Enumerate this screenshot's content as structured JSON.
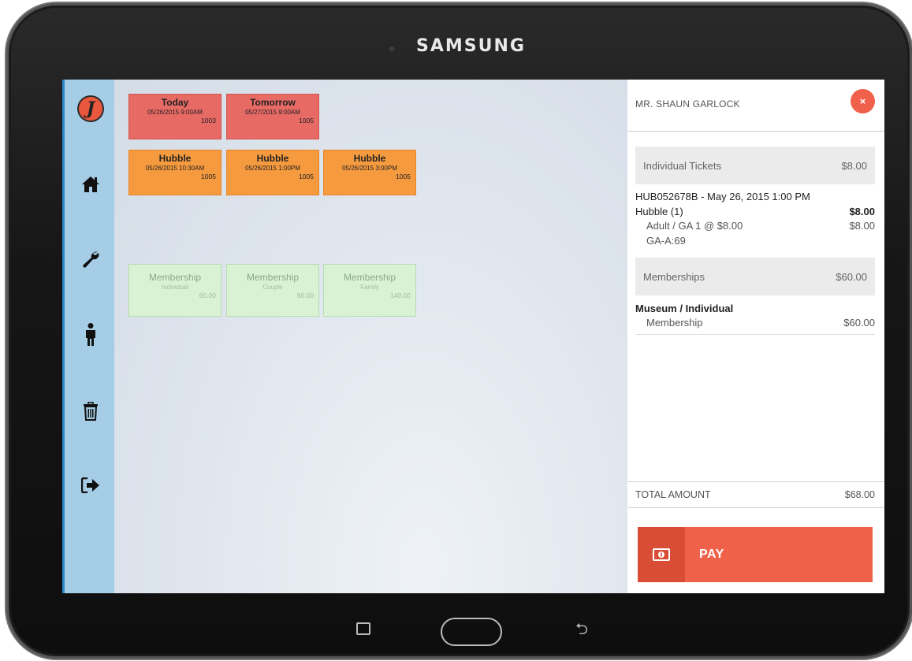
{
  "device": {
    "brand": "SAMSUNG"
  },
  "sidebar": {
    "items": [
      {
        "name": "logo",
        "glyph": "J"
      },
      {
        "name": "home",
        "icon": "home-icon"
      },
      {
        "name": "settings",
        "icon": "wrench-icon"
      },
      {
        "name": "person",
        "icon": "person-icon"
      },
      {
        "name": "delete",
        "icon": "trash-icon"
      },
      {
        "name": "logout",
        "icon": "sign-out-icon"
      }
    ]
  },
  "tiles": {
    "row1": [
      {
        "title": "Today",
        "date": "05/26/2015 9:00AM",
        "num": "1003"
      },
      {
        "title": "Tomorrow",
        "date": "05/27/2015 9:00AM",
        "num": "1005"
      }
    ],
    "row2": [
      {
        "title": "Hubble",
        "date": "05/26/2015 10:30AM",
        "num": "1005"
      },
      {
        "title": "Hubble",
        "date": "05/26/2015 1:00PM",
        "num": "1005"
      },
      {
        "title": "Hubble",
        "date": "05/26/2015 3:00PM",
        "num": "1005"
      }
    ],
    "memberships": [
      {
        "title": "Membership",
        "date": "Individual",
        "num": "60.00"
      },
      {
        "title": "Membership",
        "date": "Couple",
        "num": "90.00"
      },
      {
        "title": "Membership",
        "date": "Family",
        "num": "140.00"
      }
    ]
  },
  "cart": {
    "customer": "MR. SHAUN GARLOCK",
    "close_glyph": "×",
    "tickets": {
      "header": "Individual Tickets",
      "header_amount": "$8.00",
      "order": "HUB052678B - May 26, 2015 1:00 PM",
      "item": "Hubble (1)",
      "item_amount": "$8.00",
      "detail": "Adult / GA 1 @ $8.00",
      "detail_amount": "$8.00",
      "seat": "GA-A:69"
    },
    "memberships": {
      "header": "Memberships",
      "header_amount": "$60.00",
      "item": "Museum / Individual",
      "detail": "Membership",
      "detail_amount": "$60.00"
    },
    "total_label": "TOTAL AMOUNT",
    "total_amount": "$68.00",
    "pay_label": "PAY"
  },
  "colors": {
    "accent": "#ef6148",
    "sidebar": "#a6cde6",
    "tile_red": "#e86a65",
    "tile_orange": "#f59a3e",
    "tile_green": "#d9f2d3"
  }
}
